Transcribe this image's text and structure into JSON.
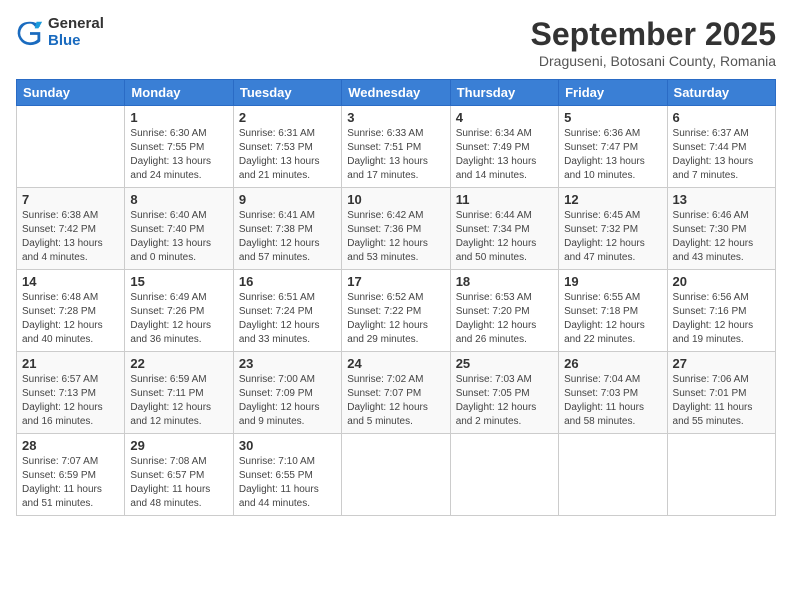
{
  "logo": {
    "general": "General",
    "blue": "Blue"
  },
  "header": {
    "month_title": "September 2025",
    "subtitle": "Draguseni, Botosani County, Romania"
  },
  "weekdays": [
    "Sunday",
    "Monday",
    "Tuesday",
    "Wednesday",
    "Thursday",
    "Friday",
    "Saturday"
  ],
  "weeks": [
    [
      {
        "day": "",
        "sunrise": "",
        "sunset": "",
        "daylight": ""
      },
      {
        "day": "1",
        "sunrise": "Sunrise: 6:30 AM",
        "sunset": "Sunset: 7:55 PM",
        "daylight": "Daylight: 13 hours and 24 minutes."
      },
      {
        "day": "2",
        "sunrise": "Sunrise: 6:31 AM",
        "sunset": "Sunset: 7:53 PM",
        "daylight": "Daylight: 13 hours and 21 minutes."
      },
      {
        "day": "3",
        "sunrise": "Sunrise: 6:33 AM",
        "sunset": "Sunset: 7:51 PM",
        "daylight": "Daylight: 13 hours and 17 minutes."
      },
      {
        "day": "4",
        "sunrise": "Sunrise: 6:34 AM",
        "sunset": "Sunset: 7:49 PM",
        "daylight": "Daylight: 13 hours and 14 minutes."
      },
      {
        "day": "5",
        "sunrise": "Sunrise: 6:36 AM",
        "sunset": "Sunset: 7:47 PM",
        "daylight": "Daylight: 13 hours and 10 minutes."
      },
      {
        "day": "6",
        "sunrise": "Sunrise: 6:37 AM",
        "sunset": "Sunset: 7:44 PM",
        "daylight": "Daylight: 13 hours and 7 minutes."
      }
    ],
    [
      {
        "day": "7",
        "sunrise": "Sunrise: 6:38 AM",
        "sunset": "Sunset: 7:42 PM",
        "daylight": "Daylight: 13 hours and 4 minutes."
      },
      {
        "day": "8",
        "sunrise": "Sunrise: 6:40 AM",
        "sunset": "Sunset: 7:40 PM",
        "daylight": "Daylight: 13 hours and 0 minutes."
      },
      {
        "day": "9",
        "sunrise": "Sunrise: 6:41 AM",
        "sunset": "Sunset: 7:38 PM",
        "daylight": "Daylight: 12 hours and 57 minutes."
      },
      {
        "day": "10",
        "sunrise": "Sunrise: 6:42 AM",
        "sunset": "Sunset: 7:36 PM",
        "daylight": "Daylight: 12 hours and 53 minutes."
      },
      {
        "day": "11",
        "sunrise": "Sunrise: 6:44 AM",
        "sunset": "Sunset: 7:34 PM",
        "daylight": "Daylight: 12 hours and 50 minutes."
      },
      {
        "day": "12",
        "sunrise": "Sunrise: 6:45 AM",
        "sunset": "Sunset: 7:32 PM",
        "daylight": "Daylight: 12 hours and 47 minutes."
      },
      {
        "day": "13",
        "sunrise": "Sunrise: 6:46 AM",
        "sunset": "Sunset: 7:30 PM",
        "daylight": "Daylight: 12 hours and 43 minutes."
      }
    ],
    [
      {
        "day": "14",
        "sunrise": "Sunrise: 6:48 AM",
        "sunset": "Sunset: 7:28 PM",
        "daylight": "Daylight: 12 hours and 40 minutes."
      },
      {
        "day": "15",
        "sunrise": "Sunrise: 6:49 AM",
        "sunset": "Sunset: 7:26 PM",
        "daylight": "Daylight: 12 hours and 36 minutes."
      },
      {
        "day": "16",
        "sunrise": "Sunrise: 6:51 AM",
        "sunset": "Sunset: 7:24 PM",
        "daylight": "Daylight: 12 hours and 33 minutes."
      },
      {
        "day": "17",
        "sunrise": "Sunrise: 6:52 AM",
        "sunset": "Sunset: 7:22 PM",
        "daylight": "Daylight: 12 hours and 29 minutes."
      },
      {
        "day": "18",
        "sunrise": "Sunrise: 6:53 AM",
        "sunset": "Sunset: 7:20 PM",
        "daylight": "Daylight: 12 hours and 26 minutes."
      },
      {
        "day": "19",
        "sunrise": "Sunrise: 6:55 AM",
        "sunset": "Sunset: 7:18 PM",
        "daylight": "Daylight: 12 hours and 22 minutes."
      },
      {
        "day": "20",
        "sunrise": "Sunrise: 6:56 AM",
        "sunset": "Sunset: 7:16 PM",
        "daylight": "Daylight: 12 hours and 19 minutes."
      }
    ],
    [
      {
        "day": "21",
        "sunrise": "Sunrise: 6:57 AM",
        "sunset": "Sunset: 7:13 PM",
        "daylight": "Daylight: 12 hours and 16 minutes."
      },
      {
        "day": "22",
        "sunrise": "Sunrise: 6:59 AM",
        "sunset": "Sunset: 7:11 PM",
        "daylight": "Daylight: 12 hours and 12 minutes."
      },
      {
        "day": "23",
        "sunrise": "Sunrise: 7:00 AM",
        "sunset": "Sunset: 7:09 PM",
        "daylight": "Daylight: 12 hours and 9 minutes."
      },
      {
        "day": "24",
        "sunrise": "Sunrise: 7:02 AM",
        "sunset": "Sunset: 7:07 PM",
        "daylight": "Daylight: 12 hours and 5 minutes."
      },
      {
        "day": "25",
        "sunrise": "Sunrise: 7:03 AM",
        "sunset": "Sunset: 7:05 PM",
        "daylight": "Daylight: 12 hours and 2 minutes."
      },
      {
        "day": "26",
        "sunrise": "Sunrise: 7:04 AM",
        "sunset": "Sunset: 7:03 PM",
        "daylight": "Daylight: 11 hours and 58 minutes."
      },
      {
        "day": "27",
        "sunrise": "Sunrise: 7:06 AM",
        "sunset": "Sunset: 7:01 PM",
        "daylight": "Daylight: 11 hours and 55 minutes."
      }
    ],
    [
      {
        "day": "28",
        "sunrise": "Sunrise: 7:07 AM",
        "sunset": "Sunset: 6:59 PM",
        "daylight": "Daylight: 11 hours and 51 minutes."
      },
      {
        "day": "29",
        "sunrise": "Sunrise: 7:08 AM",
        "sunset": "Sunset: 6:57 PM",
        "daylight": "Daylight: 11 hours and 48 minutes."
      },
      {
        "day": "30",
        "sunrise": "Sunrise: 7:10 AM",
        "sunset": "Sunset: 6:55 PM",
        "daylight": "Daylight: 11 hours and 44 minutes."
      },
      {
        "day": "",
        "sunrise": "",
        "sunset": "",
        "daylight": ""
      },
      {
        "day": "",
        "sunrise": "",
        "sunset": "",
        "daylight": ""
      },
      {
        "day": "",
        "sunrise": "",
        "sunset": "",
        "daylight": ""
      },
      {
        "day": "",
        "sunrise": "",
        "sunset": "",
        "daylight": ""
      }
    ]
  ]
}
